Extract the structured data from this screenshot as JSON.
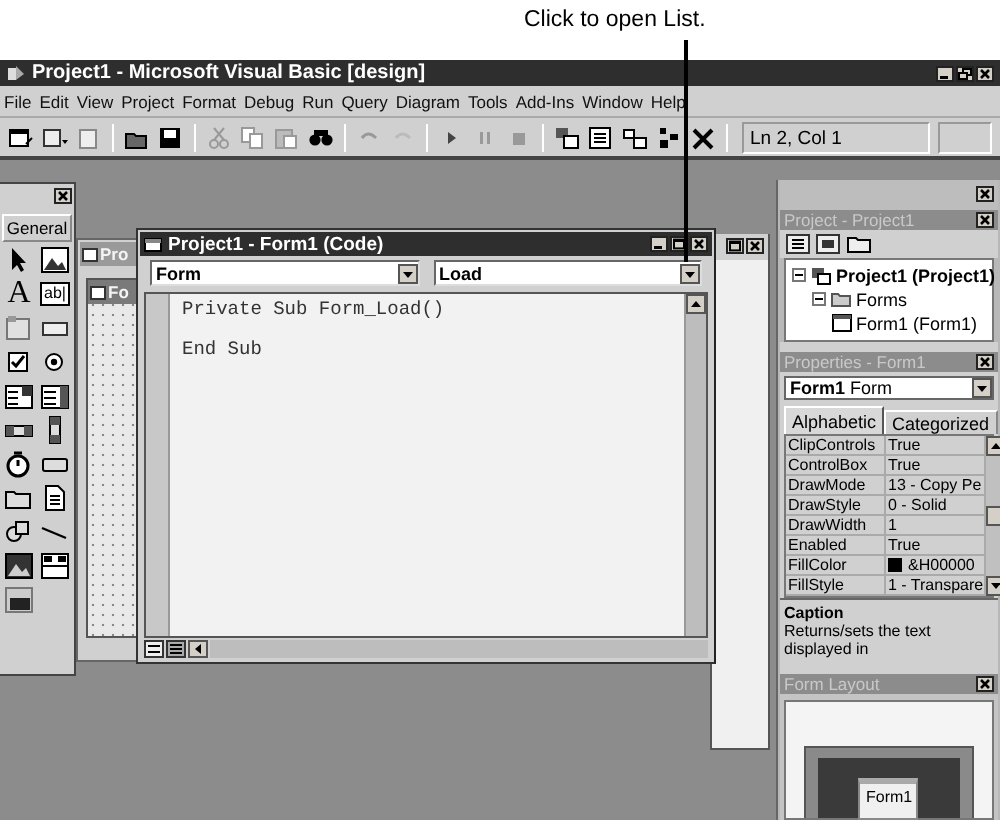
{
  "callout": {
    "text": "Click to open List."
  },
  "window": {
    "title": "Project1 - Microsoft Visual Basic [design]"
  },
  "menu": [
    "File",
    "Edit",
    "View",
    "Project",
    "Format",
    "Debug",
    "Run",
    "Query",
    "Diagram",
    "Tools",
    "Add-Ins",
    "Window",
    "Help"
  ],
  "toolbar": {
    "position": "Ln 2, Col 1"
  },
  "toolbox": {
    "tab": "General",
    "items": [
      {
        "kind": "pointer"
      },
      {
        "kind": "picture"
      },
      {
        "kind": "glyph",
        "text": "A"
      },
      {
        "kind": "glyph",
        "text": "ab|"
      },
      {
        "kind": "frame"
      },
      {
        "kind": "button"
      },
      {
        "kind": "checkbox"
      },
      {
        "kind": "radio"
      },
      {
        "kind": "combo"
      },
      {
        "kind": "list"
      },
      {
        "kind": "hscroll"
      },
      {
        "kind": "vscroll"
      },
      {
        "kind": "timer"
      },
      {
        "kind": "drive"
      },
      {
        "kind": "folder"
      },
      {
        "kind": "file"
      },
      {
        "kind": "shape"
      },
      {
        "kind": "line"
      },
      {
        "kind": "image"
      },
      {
        "kind": "data"
      },
      {
        "kind": "ole"
      }
    ]
  },
  "designer": {
    "title": "Pro",
    "form_title": "Fo"
  },
  "code_window": {
    "title": "Project1 - Form1 (Code)",
    "object": "Form",
    "procedure": "Load",
    "lines": [
      "Private Sub Form_Load()",
      "End Sub"
    ]
  },
  "project": {
    "title": "Project - Project1",
    "tree": [
      {
        "label": "Project1 (Project1)",
        "expanded": true,
        "children": [
          {
            "label": "Forms",
            "expanded": true,
            "children": [
              {
                "label": "Form1 (Form1)"
              }
            ]
          }
        ]
      }
    ]
  },
  "properties": {
    "title": "Properties - Form1",
    "object": "Form1",
    "object_type": "Form",
    "tabs": [
      {
        "label": "Alphabetic",
        "selected": true
      },
      {
        "label": "Categorized",
        "selected": false
      }
    ],
    "rows": [
      {
        "name": "ClipControls",
        "value": "True"
      },
      {
        "name": "ControlBox",
        "value": "True"
      },
      {
        "name": "DrawMode",
        "value": "13 - Copy Pe"
      },
      {
        "name": "DrawStyle",
        "value": "0 - Solid"
      },
      {
        "name": "DrawWidth",
        "value": "1"
      },
      {
        "name": "Enabled",
        "value": "True"
      },
      {
        "name": "FillColor",
        "value": "&H00000",
        "color": "#000000"
      },
      {
        "name": "FillStyle",
        "value": "1 - Transpare"
      }
    ],
    "description_title": "Caption",
    "description": "Returns/sets the text displayed in"
  },
  "form_layout": {
    "title": "Form Layout",
    "form": "Form1"
  }
}
